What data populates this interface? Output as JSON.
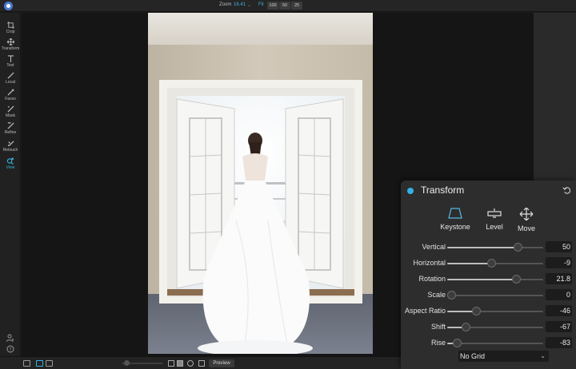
{
  "topbar": {
    "zoom_label": "Zoom",
    "zoom_value": "16.41",
    "fit_label": "Fit",
    "zoom_buttons": [
      "100",
      "50",
      "25"
    ]
  },
  "tools": [
    {
      "label": "Crop",
      "icon": "crop-icon",
      "active": false
    },
    {
      "label": "Transform",
      "icon": "transform-icon",
      "active": false
    },
    {
      "label": "Text",
      "icon": "text-icon",
      "active": false
    },
    {
      "label": "Local",
      "icon": "local-brush-icon",
      "active": false
    },
    {
      "label": "Faces",
      "icon": "faces-icon",
      "active": false
    },
    {
      "label": "Mask",
      "icon": "mask-icon",
      "active": false
    },
    {
      "label": "Refine",
      "icon": "refine-icon",
      "active": false
    },
    {
      "label": "Retouch",
      "icon": "retouch-icon",
      "active": false
    },
    {
      "label": "View",
      "icon": "view-icon",
      "active": true
    }
  ],
  "bottombar": {
    "preview_label": "Preview"
  },
  "panel": {
    "title": "Transform",
    "modes": [
      "Keystone",
      "Level",
      "Move"
    ],
    "sliders": [
      {
        "label": "Vertical",
        "value": "50",
        "fraction": 0.73
      },
      {
        "label": "Horizontal",
        "value": "-9",
        "fraction": 0.46
      },
      {
        "label": "Rotation",
        "value": "21.8",
        "fraction": 0.72
      },
      {
        "label": "Scale",
        "value": "0",
        "fraction": 0.04
      },
      {
        "label": "Aspect Ratio",
        "value": "-46",
        "fraction": 0.3
      },
      {
        "label": "Shift",
        "value": "-67",
        "fraction": 0.19
      },
      {
        "label": "Rise",
        "value": "-83",
        "fraction": 0.1
      }
    ],
    "grid_option": "No Grid"
  },
  "colors": {
    "accent": "#34b0e6",
    "panel_bg": "#2d2d2d",
    "canvas_bg": "#151515"
  }
}
